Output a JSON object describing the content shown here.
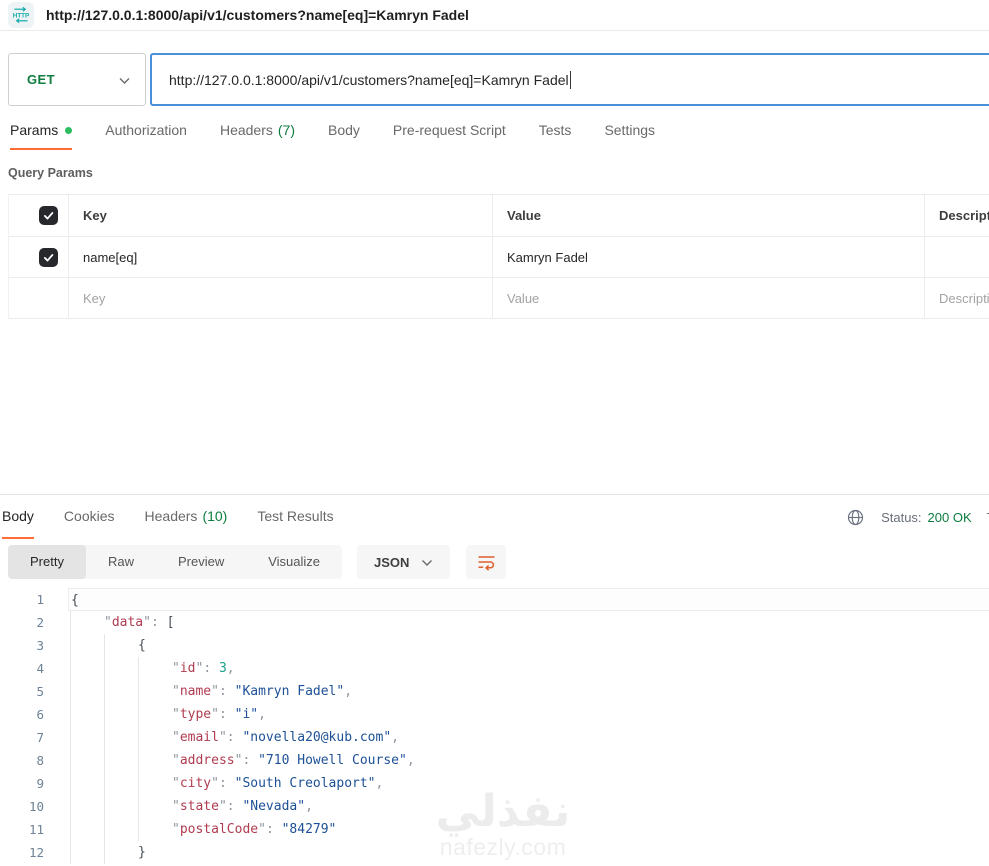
{
  "titlebar": {
    "badge": "HTTP",
    "tab_title": "http://127.0.0.1:8000/api/v1/customers?name[eq]=Kamryn Fadel"
  },
  "request": {
    "method": "GET",
    "url": "http://127.0.0.1:8000/api/v1/customers?name[eq]=Kamryn Fadel",
    "tabs": [
      {
        "label": "Params",
        "active": true,
        "dot": true
      },
      {
        "label": "Authorization"
      },
      {
        "label": "Headers",
        "badge": "(7)"
      },
      {
        "label": "Body"
      },
      {
        "label": "Pre-request Script"
      },
      {
        "label": "Tests"
      },
      {
        "label": "Settings"
      }
    ],
    "query_params": {
      "title": "Query Params",
      "columns": [
        "Key",
        "Value",
        "Description"
      ],
      "rows": [
        {
          "checked": true,
          "key": "name[eq]",
          "value": "Kamryn Fadel",
          "description": ""
        }
      ],
      "placeholders": {
        "key": "Key",
        "value": "Value",
        "description": "Description"
      }
    }
  },
  "response": {
    "tabs": [
      {
        "label": "Body",
        "active": true
      },
      {
        "label": "Cookies"
      },
      {
        "label": "Headers",
        "badge": "(10)"
      },
      {
        "label": "Test Results"
      }
    ],
    "status": {
      "label": "Status:",
      "value": "200 OK",
      "time_partial": "Ti"
    },
    "view_modes": [
      {
        "label": "Pretty",
        "active": true
      },
      {
        "label": "Raw"
      },
      {
        "label": "Preview"
      },
      {
        "label": "Visualize"
      }
    ],
    "format": "JSON",
    "code_lines": [
      {
        "n": "1",
        "indent": 0,
        "tokens": [
          [
            "brace",
            "{"
          ]
        ]
      },
      {
        "n": "2",
        "indent": 1,
        "tokens": [
          [
            "q",
            "\""
          ],
          [
            "key",
            "data"
          ],
          [
            "q",
            "\""
          ],
          [
            "punc",
            ": "
          ],
          [
            "brace",
            "["
          ]
        ]
      },
      {
        "n": "3",
        "indent": 2,
        "tokens": [
          [
            "brace",
            "{"
          ]
        ]
      },
      {
        "n": "4",
        "indent": 3,
        "tokens": [
          [
            "q",
            "\""
          ],
          [
            "key",
            "id"
          ],
          [
            "q",
            "\""
          ],
          [
            "punc",
            ": "
          ],
          [
            "num",
            "3"
          ],
          [
            "punc",
            ","
          ]
        ]
      },
      {
        "n": "5",
        "indent": 3,
        "tokens": [
          [
            "q",
            "\""
          ],
          [
            "key",
            "name"
          ],
          [
            "q",
            "\""
          ],
          [
            "punc",
            ": "
          ],
          [
            "str",
            "\"Kamryn Fadel\""
          ],
          [
            "punc",
            ","
          ]
        ]
      },
      {
        "n": "6",
        "indent": 3,
        "tokens": [
          [
            "q",
            "\""
          ],
          [
            "key",
            "type"
          ],
          [
            "q",
            "\""
          ],
          [
            "punc",
            ": "
          ],
          [
            "str",
            "\"i\""
          ],
          [
            "punc",
            ","
          ]
        ]
      },
      {
        "n": "7",
        "indent": 3,
        "tokens": [
          [
            "q",
            "\""
          ],
          [
            "key",
            "email"
          ],
          [
            "q",
            "\""
          ],
          [
            "punc",
            ": "
          ],
          [
            "str",
            "\"novella20@kub.com\""
          ],
          [
            "punc",
            ","
          ]
        ]
      },
      {
        "n": "8",
        "indent": 3,
        "tokens": [
          [
            "q",
            "\""
          ],
          [
            "key",
            "address"
          ],
          [
            "q",
            "\""
          ],
          [
            "punc",
            ": "
          ],
          [
            "str",
            "\"710 Howell Course\""
          ],
          [
            "punc",
            ","
          ]
        ]
      },
      {
        "n": "9",
        "indent": 3,
        "tokens": [
          [
            "q",
            "\""
          ],
          [
            "key",
            "city"
          ],
          [
            "q",
            "\""
          ],
          [
            "punc",
            ": "
          ],
          [
            "str",
            "\"South Creolaport\""
          ],
          [
            "punc",
            ","
          ]
        ]
      },
      {
        "n": "10",
        "indent": 3,
        "tokens": [
          [
            "q",
            "\""
          ],
          [
            "key",
            "state"
          ],
          [
            "q",
            "\""
          ],
          [
            "punc",
            ": "
          ],
          [
            "str",
            "\"Nevada\""
          ],
          [
            "punc",
            ","
          ]
        ]
      },
      {
        "n": "11",
        "indent": 3,
        "tokens": [
          [
            "q",
            "\""
          ],
          [
            "key",
            "postalCode"
          ],
          [
            "q",
            "\""
          ],
          [
            "punc",
            ": "
          ],
          [
            "str",
            "\"84279\""
          ]
        ]
      },
      {
        "n": "12",
        "indent": 2,
        "tokens": [
          [
            "brace",
            "}"
          ]
        ]
      }
    ]
  },
  "watermark": {
    "title": "نفذلي",
    "subtitle": "nafezly.com"
  },
  "colors": {
    "accent_orange": "#ff6c37",
    "green": "#0c7d3f",
    "focus_blue": "#4a90d9",
    "code_key": "#b03c50",
    "code_string": "#1d5096",
    "code_number": "#1aa08c"
  }
}
